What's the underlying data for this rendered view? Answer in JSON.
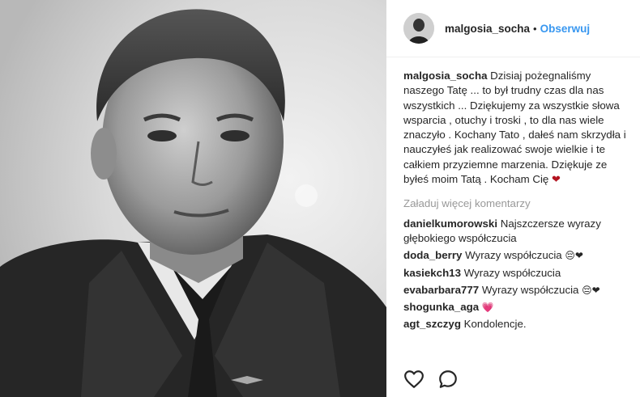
{
  "post": {
    "author": "malgosia_socha",
    "follow_label": "Obserwuj",
    "separator": "•",
    "caption": {
      "user": "malgosia_socha",
      "text": "Dzisiaj pożegnaliśmy naszego Tatę ... to był trudny czas dla nas wszystkich ... Dziękujemy za wszystkie słowa wsparcia , otuchy i troski , to dla nas wiele znaczyło . Kochany Tato , dałeś nam skrzydła i nauczyłeś jak realizować swoje wielkie i te całkiem przyziemne marzenia. Dziękuje ze byłeś moim Tatą . Kocham Cię",
      "emoji": "❤"
    },
    "load_more": "Załaduj więcej komentarzy",
    "comments": [
      {
        "user": "danielkumorowski",
        "text": "Najszczersze wyrazy głębokiego współczucia",
        "emoji": ""
      },
      {
        "user": "doda_berry",
        "text": "Wyrazy współczucia",
        "emoji": "😔❤"
      },
      {
        "user": "kasiekch13",
        "text": "Wyrazy współczucia",
        "emoji": ""
      },
      {
        "user": "evabarbara777",
        "text": "Wyrazy współczucia",
        "emoji": "😔❤"
      },
      {
        "user": "shogunka_aga",
        "text": "",
        "emoji": "💗"
      },
      {
        "user": "agt_szczyg",
        "text": "Kondolencje.",
        "emoji": ""
      }
    ],
    "icons": {
      "like": "heart-outline-icon",
      "comment": "comment-bubble-icon"
    },
    "colors": {
      "link": "#3897f0",
      "text": "#262626",
      "muted": "#999999",
      "heart": "#b3131f"
    }
  }
}
